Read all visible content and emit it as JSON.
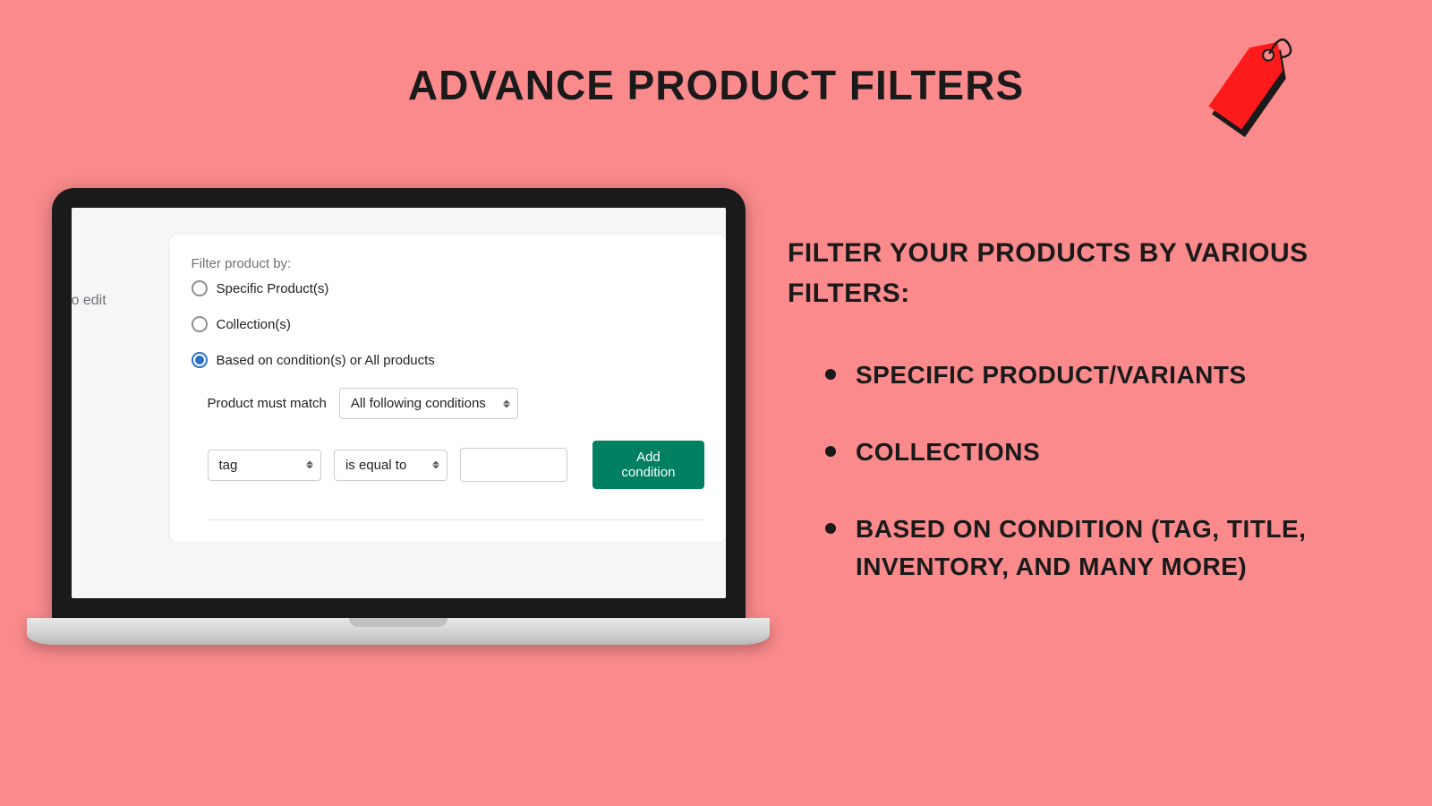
{
  "title": "ADVANCE PRODUCT FILTERS",
  "sidebar_text": "o edit",
  "card": {
    "filter_label": "Filter product by:",
    "radios": [
      {
        "label": "Specific Product(s)",
        "checked": false
      },
      {
        "label": "Collection(s)",
        "checked": false
      },
      {
        "label": "Based on condition(s) or All products",
        "checked": true
      }
    ],
    "match_label": "Product must match",
    "match_select": "All following conditions",
    "field_select": "tag",
    "operator_select": "is equal to",
    "value_input": "",
    "add_button": "Add condition"
  },
  "right": {
    "heading": "FILTER YOUR PRODUCTS BY VARIOUS FILTERS:",
    "bullets": [
      "SPECIFIC PRODUCT/VARIANTS",
      "COLLECTIONS",
      "BASED ON CONDITION (TAG, TITLE, INVENTORY, AND MANY MORE)"
    ]
  }
}
